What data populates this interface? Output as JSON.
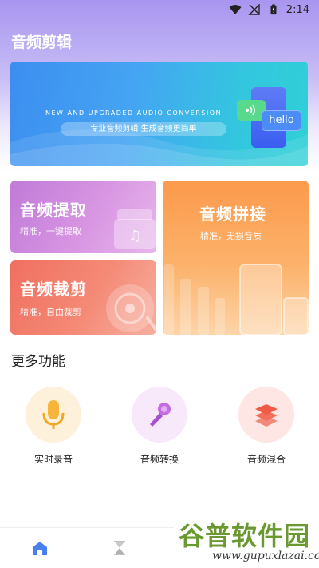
{
  "status_bar": {
    "time": "2:14"
  },
  "app": {
    "title": "音频剪辑"
  },
  "banner": {
    "english": "NEW AND UPGRADED AUDIO CONVERSION",
    "slogan": "专业音频剪辑    生成音频更简单",
    "bubble_text": "hello"
  },
  "cards": {
    "extract": {
      "title": "音频提取",
      "subtitle": "精准，一键提取"
    },
    "cut": {
      "title": "音频裁剪",
      "subtitle": "精准，自由裁剪"
    },
    "join": {
      "title": "音频拼接",
      "subtitle": "精准，无损音质"
    }
  },
  "more": {
    "title": "更多功能",
    "items": [
      {
        "label": "实时录音",
        "icon": "microphone-icon"
      },
      {
        "label": "音频转换",
        "icon": "karaoke-mic-icon"
      },
      {
        "label": "音频混合",
        "icon": "layers-icon"
      }
    ]
  },
  "tabbar": {
    "items": [
      {
        "icon": "home-icon"
      },
      {
        "icon": "hourglass-icon"
      }
    ]
  },
  "watermark": {
    "cn": "谷普软件园",
    "en": "www.gupuxlazai.com"
  },
  "colors": {
    "accent_purple": "#a995f0",
    "extract": "#c07ad8",
    "cut": "#f06f60",
    "join": "#fb9a4c",
    "home_active": "#4a7ff0"
  }
}
